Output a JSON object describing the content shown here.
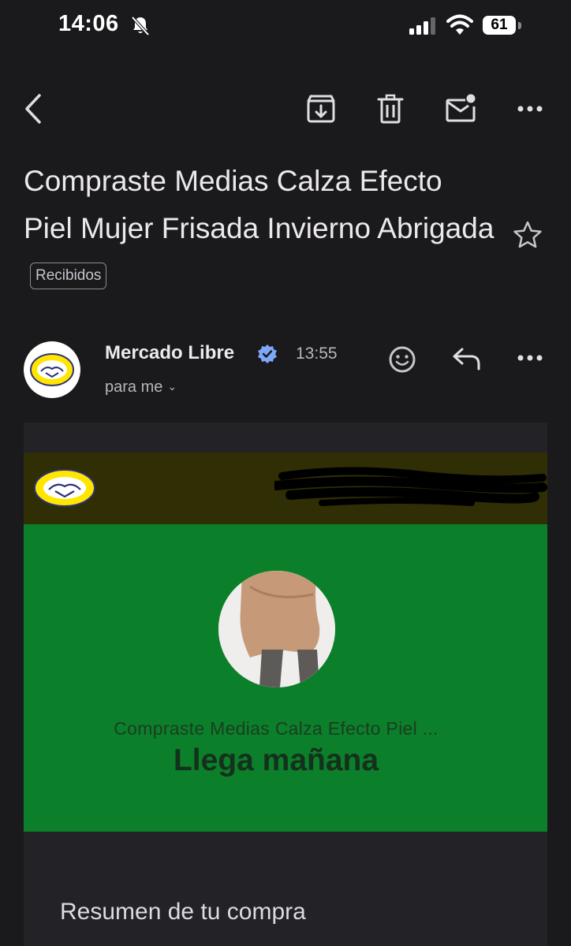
{
  "status_bar": {
    "time": "14:06",
    "battery": "61"
  },
  "email": {
    "subject": "Compraste Medias Calza Efecto Piel Mujer Frisada Invierno Abrigada",
    "label": "Recibidos",
    "sender": "Mercado Libre",
    "time": "13:55",
    "to": "para me",
    "body": {
      "product_title": "Compraste Medias Calza Efecto Piel ...",
      "delivery": "Llega mañana",
      "summary_heading": "Resumen de tu compra"
    }
  },
  "icons": {
    "toolbar": [
      "back-icon",
      "archive-icon",
      "trash-icon",
      "mark-unread-icon",
      "more-icon"
    ],
    "message": [
      "smiley-icon",
      "reply-icon",
      "more-icon"
    ]
  },
  "colors": {
    "background": "#1a191c",
    "brand_bar": "#2f2e05",
    "hero_green": "#0c7f2a",
    "verified_blue": "#7ea8f7",
    "logo_yellow": "#ffe600"
  }
}
